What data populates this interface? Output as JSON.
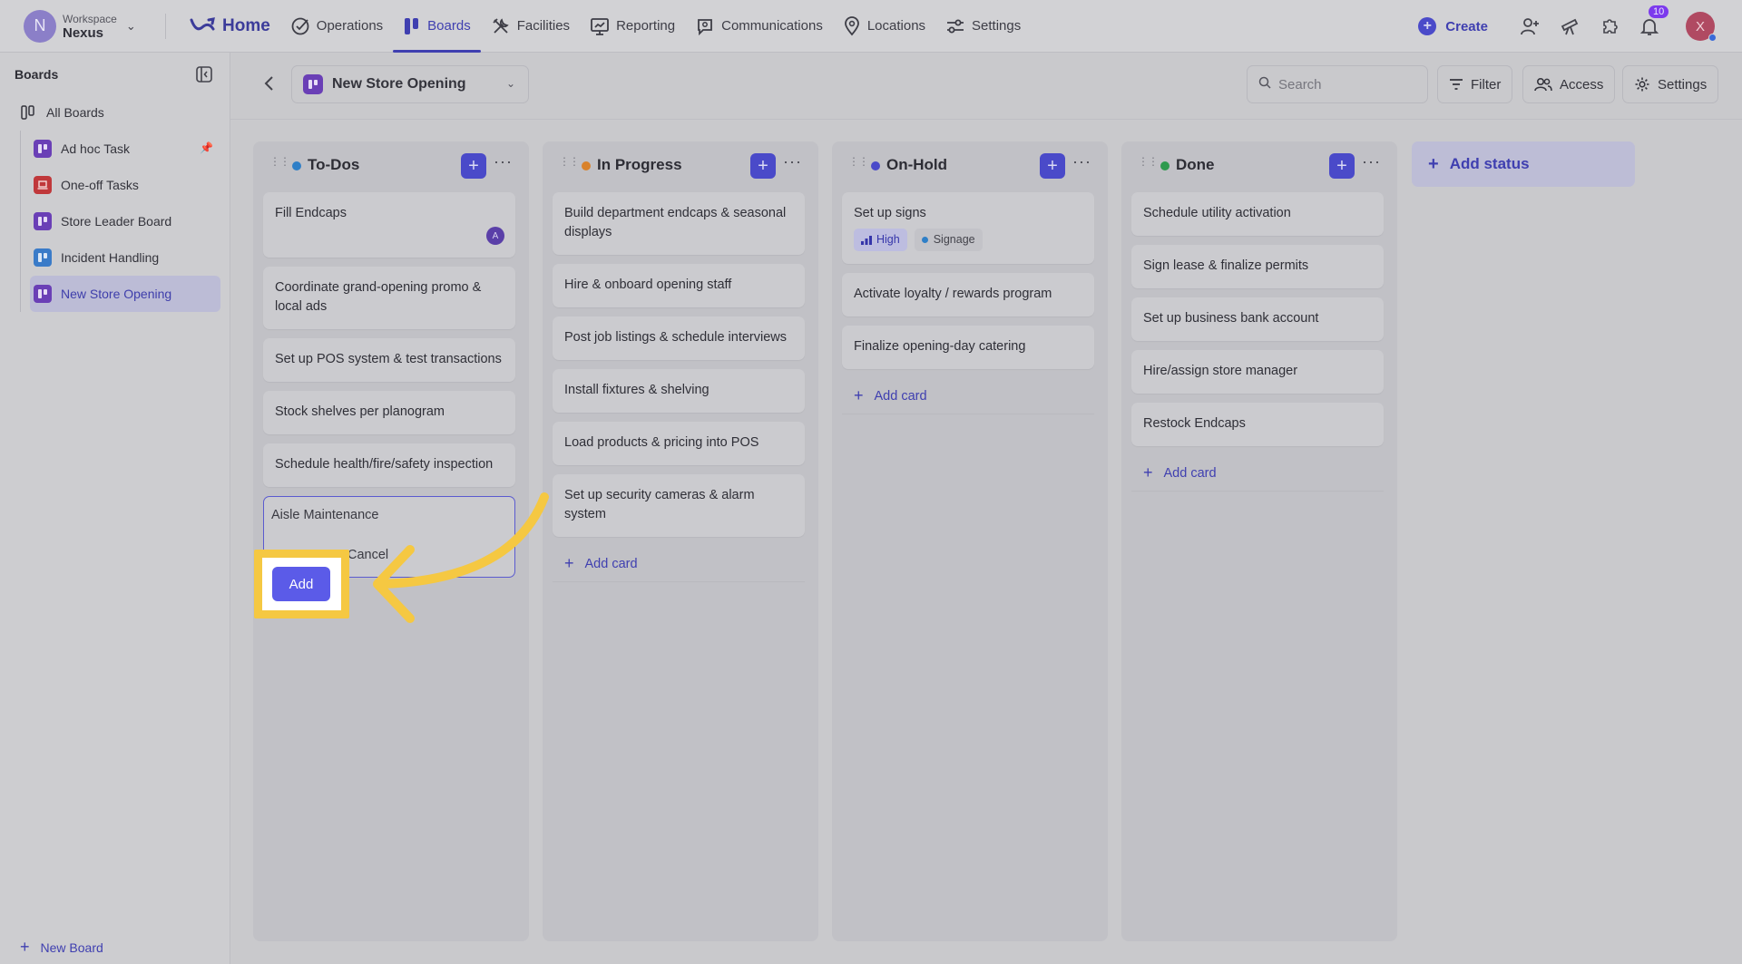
{
  "workspace": {
    "label": "Workspace",
    "name": "Nexus",
    "initial": "N"
  },
  "nav": {
    "home": "Home",
    "items": [
      {
        "label": "Operations",
        "icon": "check-circle-icon"
      },
      {
        "label": "Boards",
        "icon": "boards-icon",
        "active": true
      },
      {
        "label": "Facilities",
        "icon": "tools-icon"
      },
      {
        "label": "Reporting",
        "icon": "chart-icon"
      },
      {
        "label": "Communications",
        "icon": "chat-icon"
      },
      {
        "label": "Locations",
        "icon": "pin-icon"
      },
      {
        "label": "Settings",
        "icon": "sliders-icon"
      }
    ]
  },
  "topright": {
    "create": "Create",
    "notifications": "10",
    "user_initial": "X"
  },
  "sidebar": {
    "title": "Boards",
    "all": "All Boards",
    "items": [
      {
        "label": "Ad hoc Task",
        "color": "#6a3fb6",
        "pinned": true
      },
      {
        "label": "One-off Tasks",
        "color": "#c0383b"
      },
      {
        "label": "Store Leader Board",
        "color": "#6a3fb6"
      },
      {
        "label": "Incident Handling",
        "color": "#3a7bc8"
      },
      {
        "label": "New Store Opening",
        "color": "#6a3fb6",
        "active": true
      }
    ],
    "new_board": "New Board"
  },
  "header": {
    "board_name": "New Store Opening",
    "search_placeholder": "Search",
    "filter": "Filter",
    "access": "Access",
    "settings": "Settings"
  },
  "columns": [
    {
      "title": "To-Dos",
      "color": "#2f7fc7",
      "cards": [
        "Fill Endcaps",
        "Coordinate grand-opening promo & local ads",
        "Set up POS system & test transactions",
        "Stock shelves per planogram",
        "Schedule health/fire/safety inspection"
      ],
      "first_card_avatar": "A",
      "new_card": {
        "value": "Aisle Maintenance",
        "cancel": "Cancel",
        "add": "Add"
      }
    },
    {
      "title": "In Progress",
      "color": "#d9822b",
      "cards": [
        "Build department endcaps & seasonal displays",
        "Hire & onboard opening staff",
        "Post job listings & schedule interviews",
        "Install fixtures & shelving",
        "Load products & pricing into POS",
        "Set up security cameras & alarm system"
      ],
      "add_card": "Add card"
    },
    {
      "title": "On-Hold",
      "color": "#4a4ac9",
      "cards": [
        "Set up signs",
        "Activate loyalty / rewards program",
        "Finalize opening-day catering"
      ],
      "first_card_tags": {
        "priority": "High",
        "label": "Signage"
      },
      "add_card": "Add card"
    },
    {
      "title": "Done",
      "color": "#2e9a4e",
      "cards": [
        "Schedule utility activation",
        "Sign lease & finalize permits",
        "Set up business bank account",
        "Hire/assign store manager",
        "Restock Endcaps"
      ],
      "add_card": "Add card"
    }
  ],
  "add_status": "Add status"
}
